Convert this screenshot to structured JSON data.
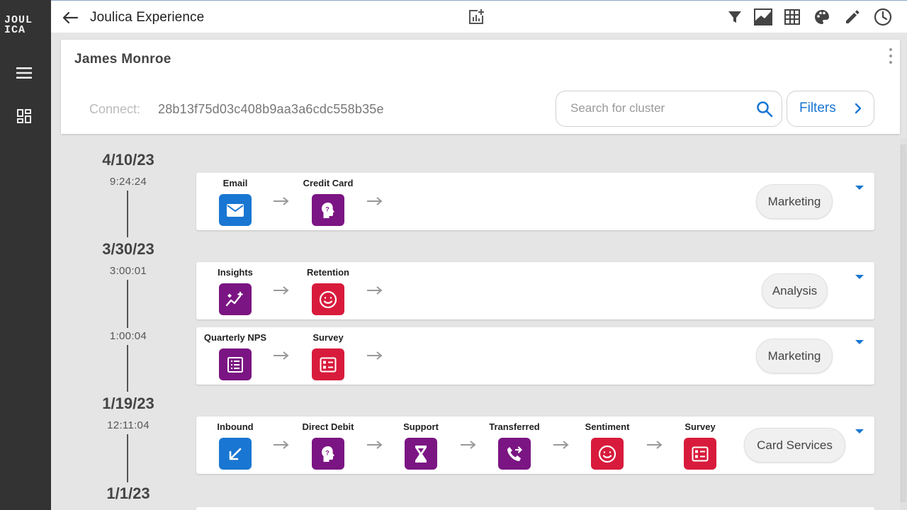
{
  "rail": {
    "logo_line1": "JOUL",
    "logo_line2": "ICA",
    "items": [
      {
        "icon": "menu-icon"
      },
      {
        "icon": "dashboard-icon"
      }
    ]
  },
  "header": {
    "title": "Joulica Experience",
    "icons": [
      "add-chart-icon",
      "filter-icon",
      "area-chart-icon",
      "grid-icon",
      "palette-icon",
      "edit-icon",
      "clock-icon"
    ]
  },
  "customer": {
    "name": "James Monroe",
    "connect_label": "Connect:",
    "connect_id": "28b13f75d03c408b9aa3a6cdc558b35e"
  },
  "search": {
    "placeholder": "Search for cluster",
    "value": ""
  },
  "filters": {
    "label": "Filters"
  },
  "colors": {
    "blue": "#1976d2",
    "purple": "#7b1583",
    "red": "#d81b3c",
    "rail": "#333333",
    "background": "#e5e5e6"
  },
  "timeline": {
    "groups": [
      {
        "date": "4/10/23",
        "times": [
          "9:24:24"
        ]
      },
      {
        "date": "3/30/23",
        "times": [
          "3:00:01",
          "1:00:04"
        ]
      },
      {
        "date": "1/19/23",
        "times": [
          "12:11:04"
        ]
      },
      {
        "date": "1/1/23",
        "times": []
      }
    ]
  },
  "journeys": [
    {
      "tag": "Marketing",
      "steps": [
        {
          "label": "Email",
          "icon": "mail-icon",
          "color": "blue"
        },
        {
          "label": "Credit Card",
          "icon": "head-question-icon",
          "color": "purple"
        }
      ]
    },
    {
      "tag": "Analysis",
      "steps": [
        {
          "label": "Insights",
          "icon": "insights-icon",
          "color": "purple"
        },
        {
          "label": "Retention",
          "icon": "smiley-icon",
          "color": "red"
        }
      ]
    },
    {
      "tag": "Marketing",
      "steps": [
        {
          "label": "Quarterly NPS",
          "icon": "list-alt-icon",
          "color": "purple"
        },
        {
          "label": "Survey",
          "icon": "survey-icon",
          "color": "red"
        }
      ]
    },
    {
      "tag": "Card Services",
      "steps": [
        {
          "label": "Inbound",
          "icon": "inbound-arrow-icon",
          "color": "blue"
        },
        {
          "label": "Direct Debit",
          "icon": "head-question-icon",
          "color": "purple"
        },
        {
          "label": "Support",
          "icon": "hourglass-icon",
          "color": "purple"
        },
        {
          "label": "Transferred",
          "icon": "phone-forward-icon",
          "color": "purple"
        },
        {
          "label": "Sentiment",
          "icon": "smiley-icon",
          "color": "red"
        },
        {
          "label": "Survey",
          "icon": "survey-icon",
          "color": "red"
        }
      ]
    }
  ]
}
